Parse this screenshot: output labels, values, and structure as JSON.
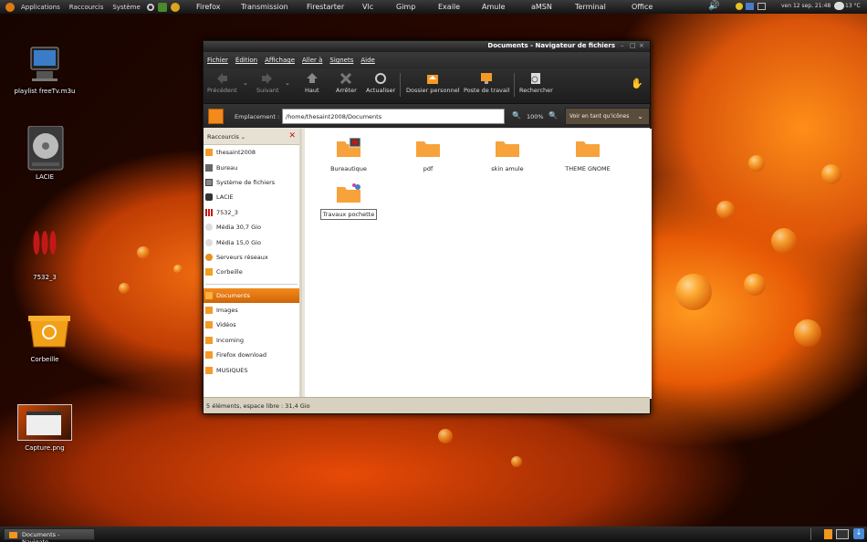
{
  "top_panel": {
    "menus": [
      "Applications",
      "Raccourcis",
      "Système"
    ],
    "launchers": [
      "Firefox",
      "Transmission",
      "Firestarter",
      "Vlc",
      "Gimp",
      "Exaile",
      "Amule",
      "aMSN",
      "Terminal",
      "Office"
    ],
    "clock": "ven 12 sep, 21:48",
    "temperature": "13 °C"
  },
  "desktop_icons": [
    {
      "label": "playlist freeTv.m3u",
      "icon": "monitor-icon"
    },
    {
      "label": "LACIE",
      "icon": "hard-disk-icon"
    },
    {
      "label": "7532_3",
      "icon": "red-capsules-icon"
    },
    {
      "label": "Corbeille",
      "icon": "trash-bin-icon"
    },
    {
      "label": "Capture.png",
      "icon": "screenshot-thumbnail-icon"
    }
  ],
  "window": {
    "title": "Documents - Navigateur de fichiers",
    "menu": [
      "Fichier",
      "Édition",
      "Affichage",
      "Aller à",
      "Signets",
      "Aide"
    ],
    "toolbar": {
      "back": "Précédent",
      "forward": "Suivant",
      "up": "Haut",
      "stop": "Arrêter",
      "reload": "Actualiser",
      "home": "Dossier personnel",
      "desktop": "Poste de travail",
      "search": "Rechercher"
    },
    "location": {
      "label": "Emplacement :",
      "path": "/home/thesaint2008/Documents",
      "zoom": "100%",
      "view_mode": "Voir en tant qu'icônes"
    },
    "sidebar": {
      "header": "Raccourcis",
      "places": [
        "thesaint2008",
        "Bureau",
        "Système de fichiers",
        "LACIE",
        "7532_3",
        "Média 30,7 Gio",
        "Média 15,0 Gio",
        "Serveurs réseaux",
        "Corbeille"
      ],
      "bookmarks": [
        "Documents",
        "Images",
        "Vidéos",
        "Incoming",
        "Firefox download",
        "MUSIQUES"
      ],
      "selected": "Documents"
    },
    "files": [
      "Bureautique",
      "pdf",
      "skin amule",
      "THEME GNOME",
      "Travaux pochette"
    ],
    "status": "5 éléments, espace libre : 31,4 Gio"
  },
  "taskbar": {
    "item": "Documents - Navigate..."
  },
  "colors": {
    "accent_orange": "#f28a1c",
    "folder": "#f7a23a",
    "panel_dark": "#1e1e1e",
    "close_red": "#c41414"
  }
}
